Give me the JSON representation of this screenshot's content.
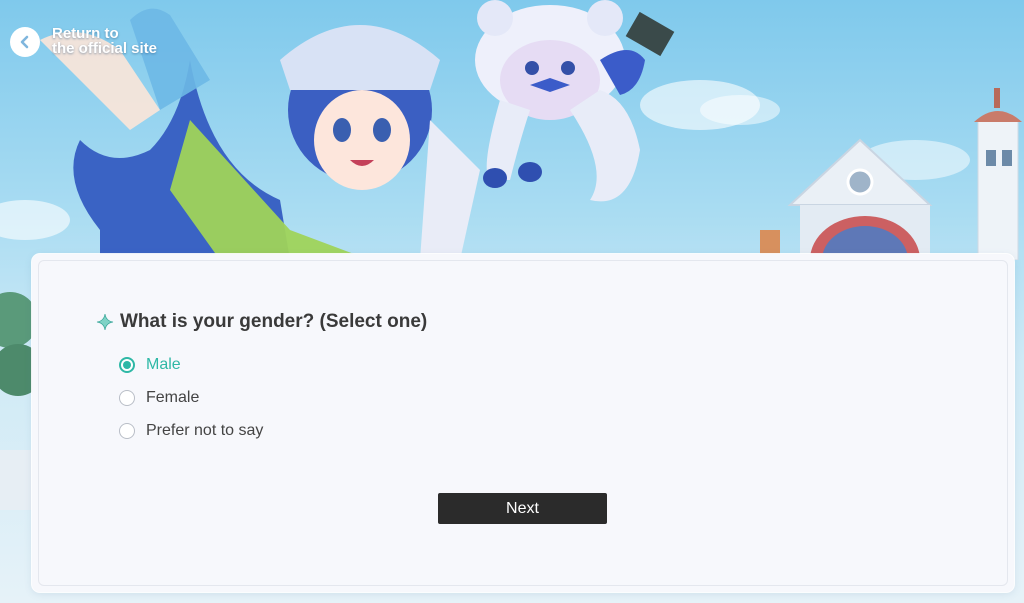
{
  "header": {
    "back_line1": "Return to",
    "back_line2": "the official site"
  },
  "survey": {
    "question": "What is your gender?  (Select one)",
    "options": [
      {
        "label": "Male",
        "selected": true
      },
      {
        "label": "Female",
        "selected": false
      },
      {
        "label": "Prefer not to say",
        "selected": false
      }
    ],
    "next_label": "Next"
  },
  "colors": {
    "accent": "#2fb8a6",
    "button_bg": "#2b2b2b",
    "sky": "#7fc9ec"
  },
  "icons": [
    "back-arrow-icon",
    "sparkle-icon"
  ]
}
